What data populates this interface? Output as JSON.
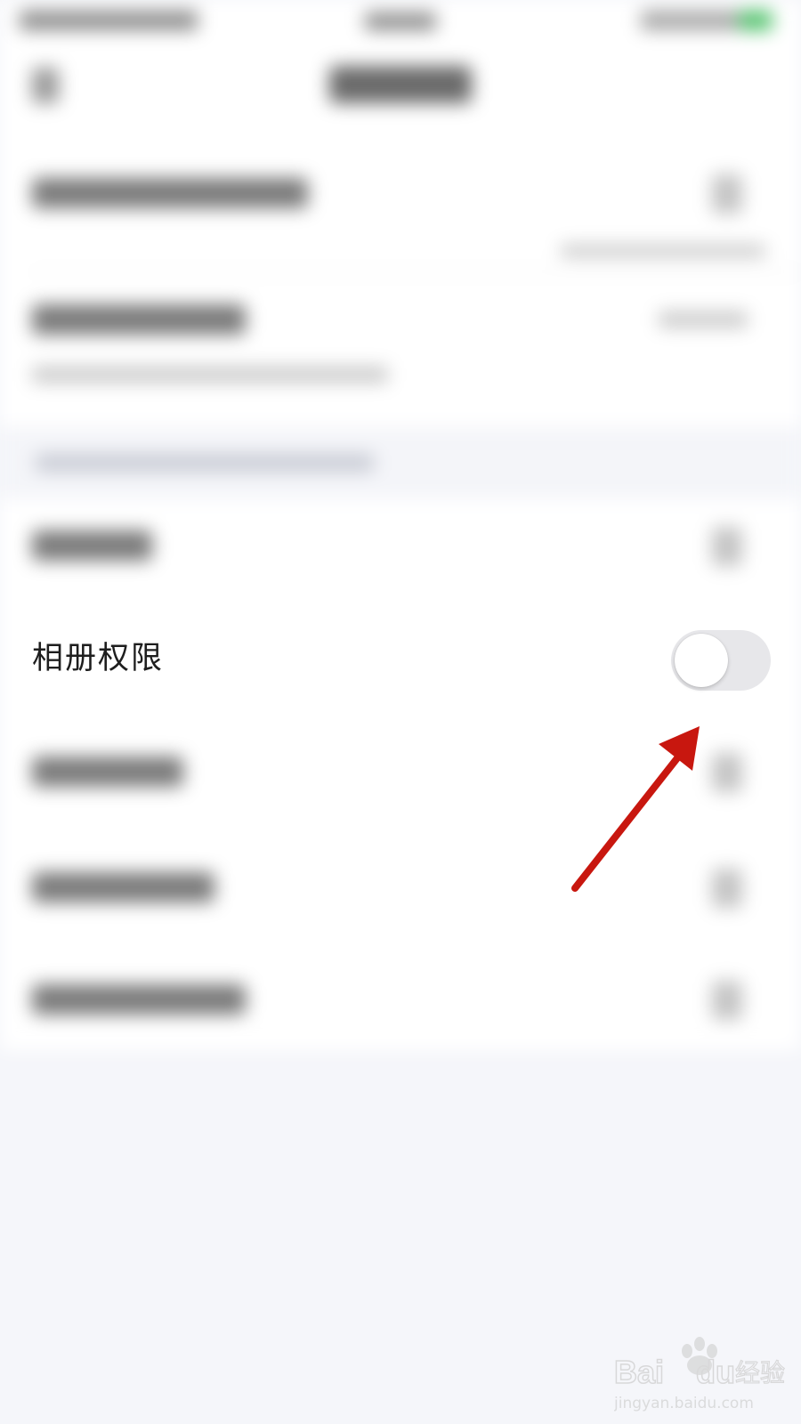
{
  "permission_row": {
    "label": "相册权限",
    "toggle_on": false
  },
  "annotation": {
    "color": "#c8170f"
  },
  "colors": {
    "background": "#f5f6fa",
    "toggle_track_off": "#e7e7ea",
    "status_battery": "#4fc16a"
  },
  "watermark": {
    "brand_text": "Bai",
    "brand_text_tail": "du",
    "product": "经验",
    "url": "jingyan.baidu.com"
  }
}
